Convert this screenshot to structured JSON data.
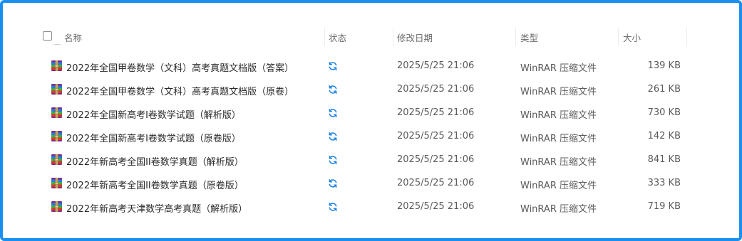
{
  "header": {
    "name": "名称",
    "status": "状态",
    "modified": "修改日期",
    "type": "类型",
    "size": "大小"
  },
  "colors": {
    "frame_border": "#1a8ff0",
    "sync_icon": "#1f86e6"
  },
  "files": [
    {
      "name": "2022年全国甲卷数学（文科）高考真题文档版（答案）",
      "status_icon": "sync-icon",
      "modified": "2025/5/25 21:06",
      "type": "WinRAR 压缩文件",
      "size": "139 KB"
    },
    {
      "name": "2022年全国甲卷数学（文科）高考真题文档版（原卷）",
      "status_icon": "sync-icon",
      "modified": "2025/5/25 21:06",
      "type": "WinRAR 压缩文件",
      "size": "261 KB"
    },
    {
      "name": "2022年全国新高考I卷数学试题（解析版）",
      "status_icon": "sync-icon",
      "modified": "2025/5/25 21:06",
      "type": "WinRAR 压缩文件",
      "size": "730 KB"
    },
    {
      "name": "2022年全国新高考I卷数学试题（原卷版）",
      "status_icon": "sync-icon",
      "modified": "2025/5/25 21:06",
      "type": "WinRAR 压缩文件",
      "size": "142 KB"
    },
    {
      "name": "2022年新高考全国II卷数学真题（解析版）",
      "status_icon": "sync-icon",
      "modified": "2025/5/25 21:06",
      "type": "WinRAR 压缩文件",
      "size": "841 KB"
    },
    {
      "name": "2022年新高考全国II卷数学真题（原卷版）",
      "status_icon": "sync-icon",
      "modified": "2025/5/25 21:06",
      "type": "WinRAR 压缩文件",
      "size": "333 KB"
    },
    {
      "name": "2022年新高考天津数学高考真题（解析版）",
      "status_icon": "sync-icon",
      "modified": "2025/5/25 21:06",
      "type": "WinRAR 压缩文件",
      "size": "719 KB"
    }
  ]
}
